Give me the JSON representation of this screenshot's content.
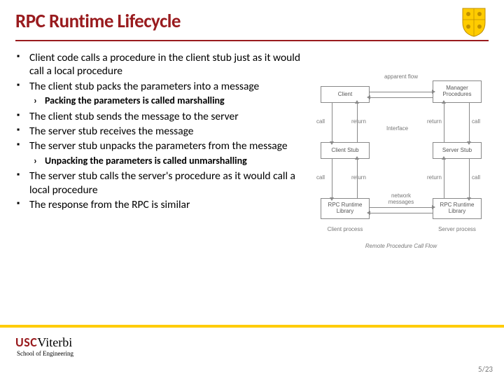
{
  "title": "RPC Runtime Lifecycle",
  "bullets": {
    "b1": "Client code calls a procedure in the client stub just as it would call a local procedure",
    "b2": "The client stub packs the parameters into a message",
    "s1a": "Packing the parameters is called ",
    "s1b": "marshalling",
    "b3": "The client stub sends the message to the server",
    "b4": "The server stub receives the message",
    "b5": "The server stub unpacks the parameters from the message",
    "s2a": "Unpacking the parameters is called ",
    "s2b": "unmarshalling",
    "b6": "The server stub calls the server's procedure as it would call a local procedure",
    "b7": "The response from the RPC is similar"
  },
  "logo": {
    "usc": "USC",
    "viterbi": "Viterbi",
    "school": "School of Engineering"
  },
  "page": "5/23",
  "diagram": {
    "client": "Client",
    "clientstub": "Client Stub",
    "rpcrt1": "RPC Runtime Library",
    "manager": "Manager Procedures",
    "serverstub": "Server Stub",
    "rpcrt2": "RPC Runtime Library",
    "call": "call",
    "return": "return",
    "apparent": "apparent flow",
    "interface": "Interface",
    "netmsg": "network messages",
    "clientproc": "Client process",
    "serverproc": "Server process",
    "caption": "Remote Procedure Call Flow"
  }
}
